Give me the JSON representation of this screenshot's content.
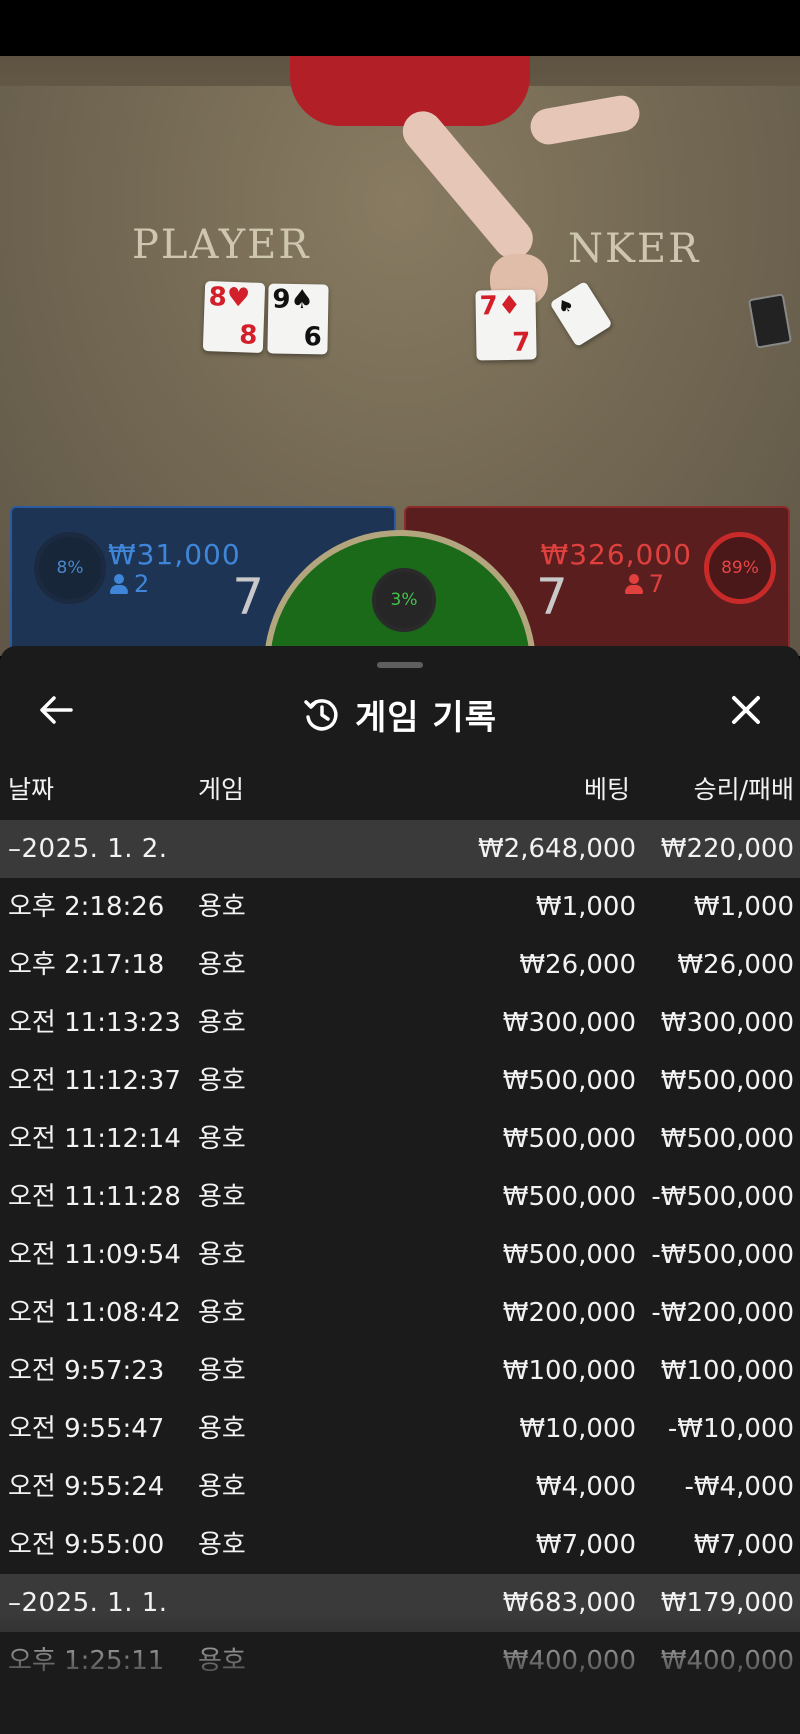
{
  "video": {
    "felt_player_label": "PLAYER",
    "felt_banker_label": "NKER",
    "player_cards": [
      {
        "rank": "8",
        "suit": "♥",
        "bottom_rank": "8",
        "color": "red"
      },
      {
        "rank": "9",
        "suit": "♠",
        "bottom_rank": "6",
        "color": "black"
      }
    ],
    "banker_cards": [
      {
        "rank": "7",
        "suit": "♦",
        "bottom_rank": "7",
        "color": "red"
      },
      {
        "rank": "",
        "suit": "♠",
        "bottom_rank": "",
        "color": "black"
      }
    ]
  },
  "bets": {
    "player": {
      "percent": "8%",
      "amount": "₩31,000",
      "count": "2",
      "score": "7",
      "color": "#3f86d9",
      "percent_value": 8
    },
    "banker": {
      "percent": "89%",
      "amount": "₩326,000",
      "count": "7",
      "score": "7",
      "color": "#e0403e",
      "percent_value": 89
    },
    "tie": {
      "percent": "3%",
      "color": "#45c24a",
      "percent_value": 3
    }
  },
  "sheet": {
    "title": "게임 기록",
    "icons": {
      "back": "arrow-left-icon",
      "title": "history-icon",
      "close": "close-icon"
    },
    "columns": {
      "date": "날짜",
      "game": "게임",
      "bet": "베팅",
      "result": "승리/패배"
    },
    "rows": [
      {
        "type": "group",
        "date": "–2025. 1. 2.",
        "game": "",
        "bet": "₩2,648,000",
        "result": "₩220,000"
      },
      {
        "type": "item",
        "date": "오후 2:18:26",
        "game": "용호",
        "bet": "₩1,000",
        "result": "₩1,000"
      },
      {
        "type": "item",
        "date": "오후 2:17:18",
        "game": "용호",
        "bet": "₩26,000",
        "result": "₩26,000"
      },
      {
        "type": "item",
        "date": "오전 11:13:23",
        "game": "용호",
        "bet": "₩300,000",
        "result": "₩300,000"
      },
      {
        "type": "item",
        "date": "오전 11:12:37",
        "game": "용호",
        "bet": "₩500,000",
        "result": "₩500,000"
      },
      {
        "type": "item",
        "date": "오전 11:12:14",
        "game": "용호",
        "bet": "₩500,000",
        "result": "₩500,000"
      },
      {
        "type": "item",
        "date": "오전 11:11:28",
        "game": "용호",
        "bet": "₩500,000",
        "result": "-₩500,000"
      },
      {
        "type": "item",
        "date": "오전 11:09:54",
        "game": "용호",
        "bet": "₩500,000",
        "result": "-₩500,000"
      },
      {
        "type": "item",
        "date": "오전 11:08:42",
        "game": "용호",
        "bet": "₩200,000",
        "result": "-₩200,000"
      },
      {
        "type": "item",
        "date": "오전 9:57:23",
        "game": "용호",
        "bet": "₩100,000",
        "result": "₩100,000"
      },
      {
        "type": "item",
        "date": "오전 9:55:47",
        "game": "용호",
        "bet": "₩10,000",
        "result": "-₩10,000"
      },
      {
        "type": "item",
        "date": "오전 9:55:24",
        "game": "용호",
        "bet": "₩4,000",
        "result": "-₩4,000"
      },
      {
        "type": "item",
        "date": "오전 9:55:00",
        "game": "용호",
        "bet": "₩7,000",
        "result": "₩7,000"
      },
      {
        "type": "group",
        "date": "–2025. 1. 1.",
        "game": "",
        "bet": "₩683,000",
        "result": "₩179,000"
      },
      {
        "type": "item",
        "date": "오후 1:25:11",
        "game": "용호",
        "bet": "₩400,000",
        "result": "₩400,000"
      }
    ]
  }
}
